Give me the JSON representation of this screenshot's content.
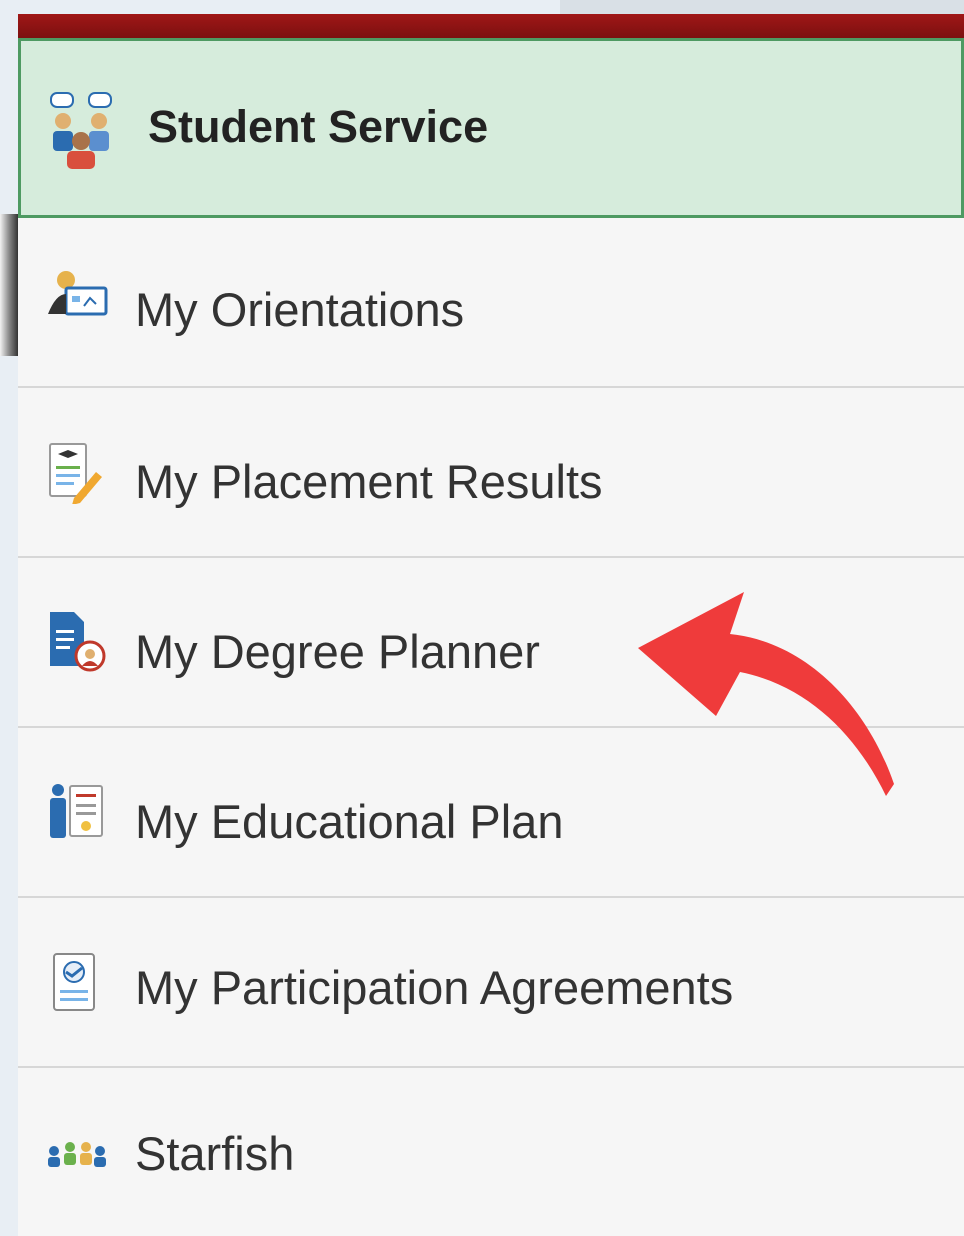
{
  "sidebar": {
    "header": {
      "label": "Student Service",
      "icon": "group-chat-icon"
    },
    "items": [
      {
        "label": "My Orientations",
        "icon": "orientation-icon"
      },
      {
        "label": "My Placement Results",
        "icon": "placement-results-icon"
      },
      {
        "label": "My Degree Planner",
        "icon": "degree-planner-icon"
      },
      {
        "label": "My Educational Plan",
        "icon": "educational-plan-icon"
      },
      {
        "label": "My Participation Agreements",
        "icon": "participation-agreements-icon"
      },
      {
        "label": "Starfish",
        "icon": "starfish-icon"
      }
    ]
  },
  "colors": {
    "header_bar": "#8b1414",
    "header_bg": "#d6ecdc",
    "header_border": "#4e9a62",
    "arrow": "#ef3b3b"
  }
}
